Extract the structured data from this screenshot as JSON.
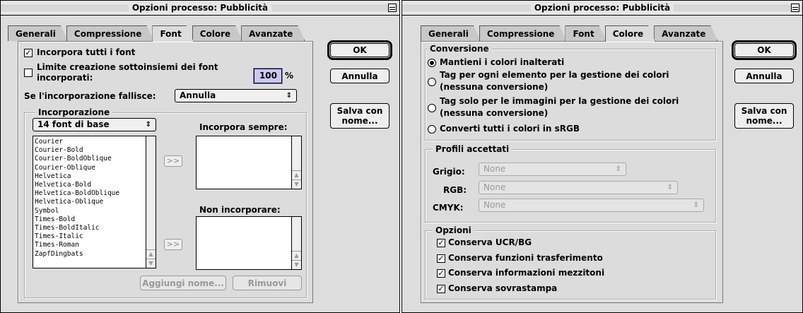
{
  "left_window": {
    "title": "Opzioni processo: Pubblicità",
    "tabs": [
      "Generali",
      "Compressione",
      "Font",
      "Colore",
      "Avanzate"
    ],
    "active_tab": "Font",
    "embed_all": {
      "label": "Incorpora tutti i font",
      "checked": true
    },
    "subset_limit": {
      "label_line1": "Limite creazione sottoinsiemi dei font",
      "label_line2": "incorporati:",
      "checked": false,
      "value": "100",
      "unit": "%"
    },
    "embed_fail": {
      "label": "Se l'incorporazione fallisce:",
      "value": "Annulla"
    },
    "embedding_group": {
      "title": "Incorporazione",
      "font_source": "14 font di base",
      "fonts": [
        "Courier",
        "Courier-Bold",
        "Courier-BoldOblique",
        "Courier-Oblique",
        "Helvetica",
        "Helvetica-Bold",
        "Helvetica-BoldOblique",
        "Helvetica-Oblique",
        "Symbol",
        "Times-Bold",
        "Times-BoldItalic",
        "Times-Italic",
        "Times-Roman",
        "ZapfDingbats"
      ],
      "always_embed_label": "Incorpora sempre:",
      "never_embed_label": "Non incorporare:",
      "move_button": ">>",
      "add_name_button": "Aggiungi nome...",
      "remove_button": "Rimuovi"
    },
    "buttons": {
      "ok": "OK",
      "cancel": "Annulla",
      "save_as_line1": "Salva con",
      "save_as_line2": "nome..."
    }
  },
  "right_window": {
    "title": "Opzioni processo: Pubblicità",
    "tabs": [
      "Generali",
      "Compressione",
      "Font",
      "Colore",
      "Avanzate"
    ],
    "active_tab": "Colore",
    "conversion_group": {
      "title": "Conversione",
      "options": [
        {
          "line1": "Mantieni i colori inalterati",
          "line2": "",
          "selected": true
        },
        {
          "line1": "Tag per ogni elemento per la gestione dei colori",
          "line2": "(nessuna conversione)",
          "selected": false
        },
        {
          "line1": "Tag solo per le immagini per la gestione dei colori",
          "line2": "(nessuna conversione)",
          "selected": false
        },
        {
          "line1": "Converti tutti i colori in sRGB",
          "line2": "",
          "selected": false
        }
      ]
    },
    "profiles_group": {
      "title": "Profili accettati",
      "gray_label": "Grigio:",
      "gray_value": "None",
      "rgb_label": "RGB:",
      "rgb_value": "None",
      "cmyk_label": "CMYK:",
      "cmyk_value": "None"
    },
    "options_group": {
      "title": "Opzioni",
      "items": [
        {
          "label": "Conserva UCR/BG",
          "checked": true
        },
        {
          "label": "Conserva funzioni trasferimento",
          "checked": true
        },
        {
          "label": "Conserva informazioni mezzitoni",
          "checked": true
        },
        {
          "label": "Conserva sovrastampa",
          "checked": true
        }
      ]
    },
    "buttons": {
      "ok": "OK",
      "cancel": "Annulla",
      "save_as_line1": "Salva con",
      "save_as_line2": "nome..."
    }
  },
  "icons": {
    "checkmark": "☑",
    "popup_arrows": "⇕",
    "scroll_up": "▲",
    "scroll_down": "▼"
  }
}
